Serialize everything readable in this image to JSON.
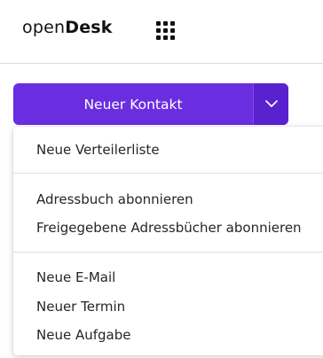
{
  "header": {
    "logo_light": "open",
    "logo_bold": "Desk",
    "apps_icon": "grid-apps-icon"
  },
  "button": {
    "label": "Neuer Kontakt",
    "toggle_icon": "chevron-down-icon",
    "accent": "#6a2ee0"
  },
  "menu": {
    "group1": [
      "Neue Verteilerliste"
    ],
    "group2": [
      "Adressbuch abonnieren",
      "Freigegebene Adressbücher abonnieren"
    ],
    "group3": [
      "Neue E-Mail",
      "Neuer Termin",
      "Neue Aufgabe"
    ]
  }
}
